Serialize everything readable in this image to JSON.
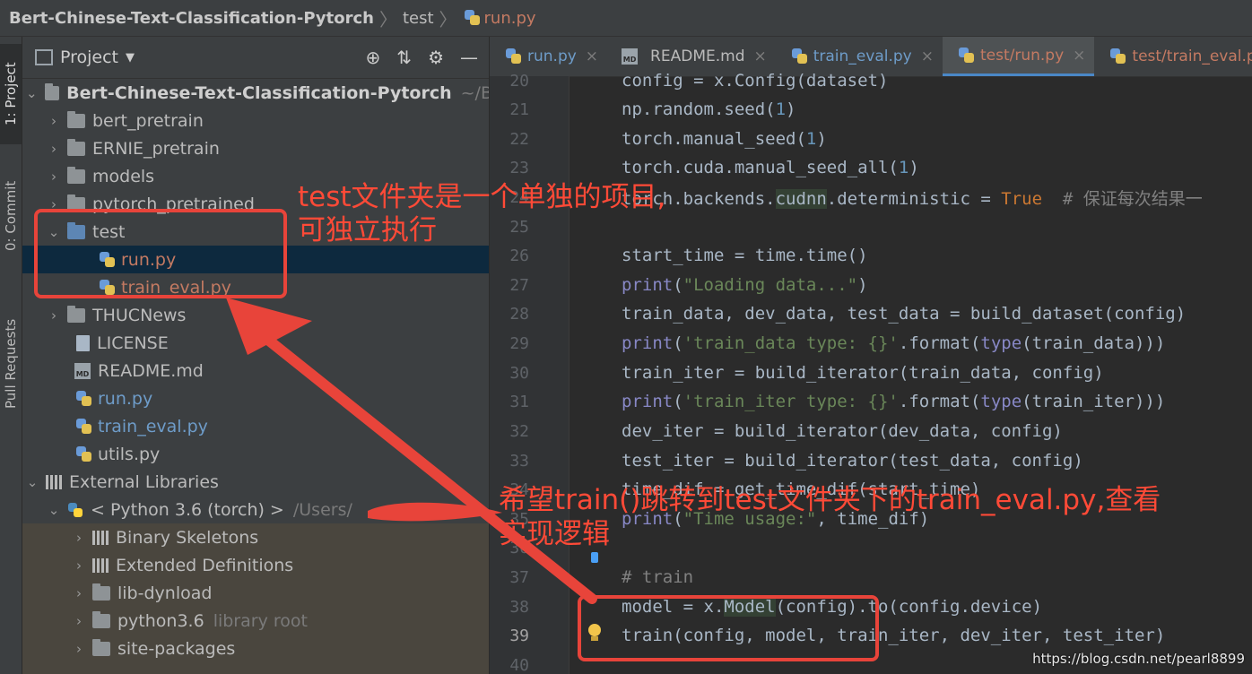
{
  "titlebar": {
    "project": "Bert-Chinese-Text-Classification-Pytorch",
    "crumb1": "test",
    "crumb2": "run.py"
  },
  "stripe": {
    "project_tab": "1: Project",
    "commit_tab": "0: Commit",
    "pull_tab": "Pull Requests"
  },
  "panel": {
    "title": "Project",
    "tree": [
      {
        "label": "Bert-Chinese-Text-Classification-Pytorch",
        "suffix": "~/B"
      },
      {
        "label": "bert_pretrain"
      },
      {
        "label": "ERNIE_pretrain"
      },
      {
        "label": "models"
      },
      {
        "label": "pytorch_pretrained"
      },
      {
        "label": "test"
      },
      {
        "label": "run.py"
      },
      {
        "label": "train_eval.py"
      },
      {
        "label": "THUCNews"
      },
      {
        "label": "LICENSE"
      },
      {
        "label": "README.md"
      },
      {
        "label": "run.py"
      },
      {
        "label": "train_eval.py"
      },
      {
        "label": "utils.py"
      },
      {
        "label": "External Libraries"
      },
      {
        "label": "< Python 3.6 (torch) >",
        "suffix": "/Users/"
      },
      {
        "label": "Binary Skeletons"
      },
      {
        "label": "Extended Definitions"
      },
      {
        "label": "lib-dynload"
      },
      {
        "label": "python3.6",
        "suffix": "library root"
      },
      {
        "label": "site-packages"
      }
    ]
  },
  "tabs": [
    {
      "label": "run.py"
    },
    {
      "label": "README.md"
    },
    {
      "label": "train_eval.py"
    },
    {
      "label": "test/run.py"
    },
    {
      "label": "test/train_eval.py"
    }
  ],
  "code": {
    "line_numbers": [
      "20",
      "21",
      "22",
      "23",
      "24",
      "25",
      "26",
      "27",
      "28",
      "29",
      "30",
      "31",
      "32",
      "33",
      "34",
      "35",
      "36",
      "37",
      "38",
      "39",
      "40"
    ],
    "l20": "config = x.Config(dataset)",
    "l21a": "np.random.seed(",
    "l21n": "1",
    "l21b": ")",
    "l22a": "torch.manual_seed(",
    "l22n": "1",
    "l22b": ")",
    "l23a": "torch.cuda.manual_seed_all(",
    "l23n": "1",
    "l23b": ")",
    "l24a": "torch.backends.",
    "l24hl": "cudnn",
    "l24b": ".deterministic = ",
    "l24t": "True",
    "l24c": "  # 保证每次结果一",
    "l26": "start_time = time.time()",
    "l27p": "print",
    "l27s": "\"Loading data...\"",
    "l28": "train_data, dev_data, test_data = build_dataset(config)",
    "l29p": "print",
    "l29s": "'train_data type: {}'",
    "l29a": ".format(",
    "l29t": "type",
    "l29b": "(train_data)))",
    "l30": "train_iter = build_iterator(train_data, config)",
    "l31p": "print",
    "l31s": "'train_iter type: {}'",
    "l31a": ".format(",
    "l31t": "type",
    "l31b": "(train_iter)))",
    "l32": "dev_iter = build_iterator(dev_data, config)",
    "l33": "test_iter = build_iterator(test_data, config)",
    "l34": "time_dif = get_time_dif(start_time)",
    "l35p": "print",
    "l35s": "\"Time usage:\"",
    "l35b": ", time_dif)",
    "l37": "# train",
    "l38a": "model = x.",
    "l38hl": "Model",
    "l38b": "(config).to(config.device)",
    "l39": "train(config, model, train_iter, dev_iter, test_iter)"
  },
  "annotations": {
    "a1_line1": "test文件夹是一个单独的项目,",
    "a1_line2": "可独立执行",
    "a2_line1": "希望train()跳转到test文件夹下的train_eval.py,查看",
    "a2_line2": "实现逻辑",
    "color": "#e8443a"
  },
  "watermark": "https://blog.csdn.net/pearl8899"
}
